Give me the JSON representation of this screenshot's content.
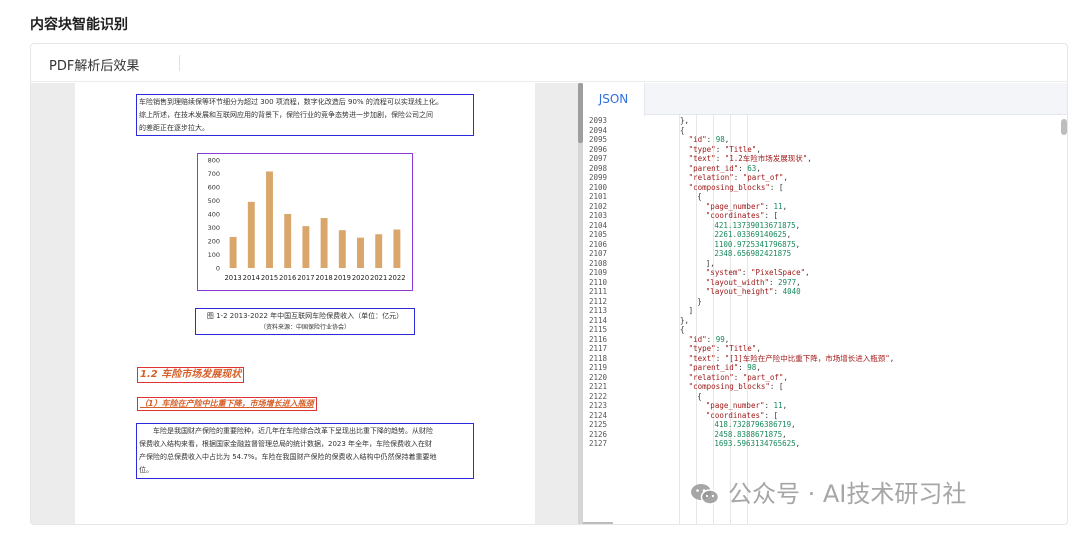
{
  "section": {
    "title": "内容块智能识别"
  },
  "card": {
    "tab_label": "PDF解析后效果"
  },
  "pdf": {
    "intro_lines": [
      "车险销售到理赔续保等环节细分为超过 300 项流程，数字化改造后 90% 的流程可以实现线上化。",
      "综上所述，在技术发展和互联网应用的背景下，保险行业的竞争态势进一步加剧，保险公司之间",
      "的差距正在逐步拉大。"
    ],
    "caption_line1": "图 1-2 2013-2022 年中国互联网车险保费收入（单位：亿元）",
    "caption_line2": "（资料来源：中国保险行业协会）",
    "title1": "1.2 车险市场发展现状",
    "title2": "（1）车险在产险中比重下降，市场增长进入瓶颈",
    "body_lines": [
      "车险是我国财产保险的重要险种，近几年在车险综合改革下呈现出比重下降的趋势。从财险",
      "保费收入结构来看，根据国家金融监督管理总局的统计数据，2023 年全年，车险保费收入在财",
      "产保险的总保费收入中占比为 54.7%。车险在我国财产保险的保费收入结构中仍然保持着重要地",
      "位。"
    ]
  },
  "chart_data": {
    "type": "bar",
    "categories": [
      "2013",
      "2014",
      "2015",
      "2016",
      "2017",
      "2018",
      "2019",
      "2020",
      "2021",
      "2022"
    ],
    "values": [
      230,
      490,
      715,
      400,
      310,
      370,
      280,
      225,
      250,
      285
    ],
    "ylim": [
      0,
      800
    ],
    "yticks": [
      0,
      100,
      200,
      300,
      400,
      500,
      600,
      700,
      800
    ],
    "bar_color": "#d9a66b",
    "grid": false
  },
  "json_view": {
    "tab_label": "JSON",
    "lines": [
      {
        "n": "2093",
        "indent": 5,
        "segments": [
          {
            "t": "},",
            "c": "p"
          }
        ]
      },
      {
        "n": "2094",
        "indent": 5,
        "segments": [
          {
            "t": "{",
            "c": "p"
          }
        ]
      },
      {
        "n": "2095",
        "indent": 6,
        "segments": [
          {
            "t": "\"id\"",
            "c": "k"
          },
          {
            "t": ": ",
            "c": "p"
          },
          {
            "t": "98",
            "c": "n"
          },
          {
            "t": ",",
            "c": "p"
          }
        ]
      },
      {
        "n": "2096",
        "indent": 6,
        "segments": [
          {
            "t": "\"type\"",
            "c": "k"
          },
          {
            "t": ": ",
            "c": "p"
          },
          {
            "t": "\"Title\"",
            "c": "s"
          },
          {
            "t": ",",
            "c": "p"
          }
        ]
      },
      {
        "n": "2097",
        "indent": 6,
        "segments": [
          {
            "t": "\"text\"",
            "c": "k"
          },
          {
            "t": ": ",
            "c": "p"
          },
          {
            "t": "\"1.2车险市场发展现状\"",
            "c": "s"
          },
          {
            "t": ",",
            "c": "p"
          }
        ]
      },
      {
        "n": "2098",
        "indent": 6,
        "segments": [
          {
            "t": "\"parent_id\"",
            "c": "k"
          },
          {
            "t": ": ",
            "c": "p"
          },
          {
            "t": "63",
            "c": "n"
          },
          {
            "t": ",",
            "c": "p"
          }
        ]
      },
      {
        "n": "2099",
        "indent": 6,
        "segments": [
          {
            "t": "\"relation\"",
            "c": "k"
          },
          {
            "t": ": ",
            "c": "p"
          },
          {
            "t": "\"part_of\"",
            "c": "s"
          },
          {
            "t": ",",
            "c": "p"
          }
        ]
      },
      {
        "n": "2100",
        "indent": 6,
        "segments": [
          {
            "t": "\"composing_blocks\"",
            "c": "k"
          },
          {
            "t": ": [",
            "c": "p"
          }
        ]
      },
      {
        "n": "2101",
        "indent": 7,
        "segments": [
          {
            "t": "{",
            "c": "p"
          }
        ]
      },
      {
        "n": "2102",
        "indent": 8,
        "segments": [
          {
            "t": "\"page_number\"",
            "c": "k"
          },
          {
            "t": ": ",
            "c": "p"
          },
          {
            "t": "11",
            "c": "n"
          },
          {
            "t": ",",
            "c": "p"
          }
        ]
      },
      {
        "n": "2103",
        "indent": 8,
        "segments": [
          {
            "t": "\"coordinates\"",
            "c": "k"
          },
          {
            "t": ": [",
            "c": "p"
          }
        ]
      },
      {
        "n": "2104",
        "indent": 9,
        "segments": [
          {
            "t": "421.13739013671875",
            "c": "n"
          },
          {
            "t": ",",
            "c": "p"
          }
        ]
      },
      {
        "n": "2105",
        "indent": 9,
        "segments": [
          {
            "t": "2261.03369140625",
            "c": "n"
          },
          {
            "t": ",",
            "c": "p"
          }
        ]
      },
      {
        "n": "2106",
        "indent": 9,
        "segments": [
          {
            "t": "1100.9725341796875",
            "c": "n"
          },
          {
            "t": ",",
            "c": "p"
          }
        ]
      },
      {
        "n": "2107",
        "indent": 9,
        "segments": [
          {
            "t": "2348.656982421875",
            "c": "n"
          }
        ]
      },
      {
        "n": "2108",
        "indent": 8,
        "segments": [
          {
            "t": "],",
            "c": "p"
          }
        ]
      },
      {
        "n": "2109",
        "indent": 8,
        "segments": [
          {
            "t": "\"system\"",
            "c": "k"
          },
          {
            "t": ": ",
            "c": "p"
          },
          {
            "t": "\"PixelSpace\"",
            "c": "s"
          },
          {
            "t": ",",
            "c": "p"
          }
        ]
      },
      {
        "n": "2110",
        "indent": 8,
        "segments": [
          {
            "t": "\"layout_width\"",
            "c": "k"
          },
          {
            "t": ": ",
            "c": "p"
          },
          {
            "t": "2977",
            "c": "n"
          },
          {
            "t": ",",
            "c": "p"
          }
        ]
      },
      {
        "n": "2111",
        "indent": 8,
        "segments": [
          {
            "t": "\"layout_height\"",
            "c": "k"
          },
          {
            "t": ": ",
            "c": "p"
          },
          {
            "t": "4040",
            "c": "n"
          }
        ]
      },
      {
        "n": "2112",
        "indent": 7,
        "segments": [
          {
            "t": "}",
            "c": "p"
          }
        ]
      },
      {
        "n": "2113",
        "indent": 6,
        "segments": [
          {
            "t": "]",
            "c": "p"
          }
        ]
      },
      {
        "n": "2114",
        "indent": 5,
        "segments": [
          {
            "t": "},",
            "c": "p"
          }
        ]
      },
      {
        "n": "2115",
        "indent": 5,
        "segments": [
          {
            "t": "{",
            "c": "p"
          }
        ]
      },
      {
        "n": "2116",
        "indent": 6,
        "segments": [
          {
            "t": "\"id\"",
            "c": "k"
          },
          {
            "t": ": ",
            "c": "p"
          },
          {
            "t": "99",
            "c": "n"
          },
          {
            "t": ",",
            "c": "p"
          }
        ]
      },
      {
        "n": "2117",
        "indent": 6,
        "segments": [
          {
            "t": "\"type\"",
            "c": "k"
          },
          {
            "t": ": ",
            "c": "p"
          },
          {
            "t": "\"Title\"",
            "c": "s"
          },
          {
            "t": ",",
            "c": "p"
          }
        ]
      },
      {
        "n": "2118",
        "indent": 6,
        "segments": [
          {
            "t": "\"text\"",
            "c": "k"
          },
          {
            "t": ": ",
            "c": "p"
          },
          {
            "t": "\"[1]车险在产险中比重下降，市场增长进入瓶颈\"",
            "c": "s"
          },
          {
            "t": ",",
            "c": "p"
          }
        ]
      },
      {
        "n": "2119",
        "indent": 6,
        "segments": [
          {
            "t": "\"parent_id\"",
            "c": "k"
          },
          {
            "t": ": ",
            "c": "p"
          },
          {
            "t": "98",
            "c": "n"
          },
          {
            "t": ",",
            "c": "p"
          }
        ]
      },
      {
        "n": "2120",
        "indent": 6,
        "segments": [
          {
            "t": "\"relation\"",
            "c": "k"
          },
          {
            "t": ": ",
            "c": "p"
          },
          {
            "t": "\"part_of\"",
            "c": "s"
          },
          {
            "t": ",",
            "c": "p"
          }
        ]
      },
      {
        "n": "2121",
        "indent": 6,
        "segments": [
          {
            "t": "\"composing_blocks\"",
            "c": "k"
          },
          {
            "t": ": [",
            "c": "p"
          }
        ]
      },
      {
        "n": "2122",
        "indent": 7,
        "segments": [
          {
            "t": "{",
            "c": "p"
          }
        ]
      },
      {
        "n": "2123",
        "indent": 8,
        "segments": [
          {
            "t": "\"page_number\"",
            "c": "k"
          },
          {
            "t": ": ",
            "c": "p"
          },
          {
            "t": "11",
            "c": "n"
          },
          {
            "t": ",",
            "c": "p"
          }
        ]
      },
      {
        "n": "2124",
        "indent": 8,
        "segments": [
          {
            "t": "\"coordinates\"",
            "c": "k"
          },
          {
            "t": ": [",
            "c": "p"
          }
        ]
      },
      {
        "n": "2125",
        "indent": 9,
        "segments": [
          {
            "t": "418.7328796386719",
            "c": "n"
          },
          {
            "t": ",",
            "c": "p"
          }
        ]
      },
      {
        "n": "2126",
        "indent": 9,
        "segments": [
          {
            "t": "2458.8388671875",
            "c": "n"
          },
          {
            "t": ",",
            "c": "p"
          }
        ]
      },
      {
        "n": "2127",
        "indent": 9,
        "segments": [
          {
            "t": "1693.5963134765625",
            "c": "n"
          },
          {
            "t": ",",
            "c": "p"
          }
        ]
      }
    ]
  },
  "watermark": {
    "text": "公众号 · AI技术研习社",
    "icon": "wechat-icon"
  }
}
